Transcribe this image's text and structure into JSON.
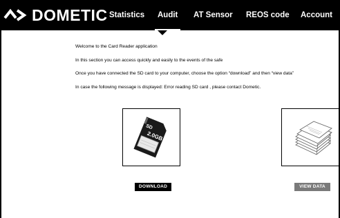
{
  "header": {
    "brand": "DOMETIC",
    "tabs": [
      {
        "label": "Statistics"
      },
      {
        "label": "Audit",
        "active": true
      },
      {
        "label": "AT Sensor"
      },
      {
        "label": "REOS code"
      },
      {
        "label": "Account"
      }
    ]
  },
  "intro": {
    "lines": [
      "Welcome to the Card Reader application",
      "In this section you can access quickly and easily to the events of the safe",
      "Once you have connected the SD card to your computer, choose the option “download” and then “view data”",
      "In case the following message is displayed: Error reading SD card , please contact Dometic."
    ]
  },
  "actions": {
    "sd_card_label": "2.0GB",
    "download_label": "DOWNLOAD",
    "view_data_label": "VIEW DATA"
  },
  "icons": {
    "brand_mark": "dometic-logo-mark",
    "sd_card": "sd-card-icon",
    "documents": "documents-stack-icon"
  },
  "colors": {
    "header_bg": "#000000",
    "download_bg": "#000000",
    "view_data_bg": "#7a7a7a"
  }
}
